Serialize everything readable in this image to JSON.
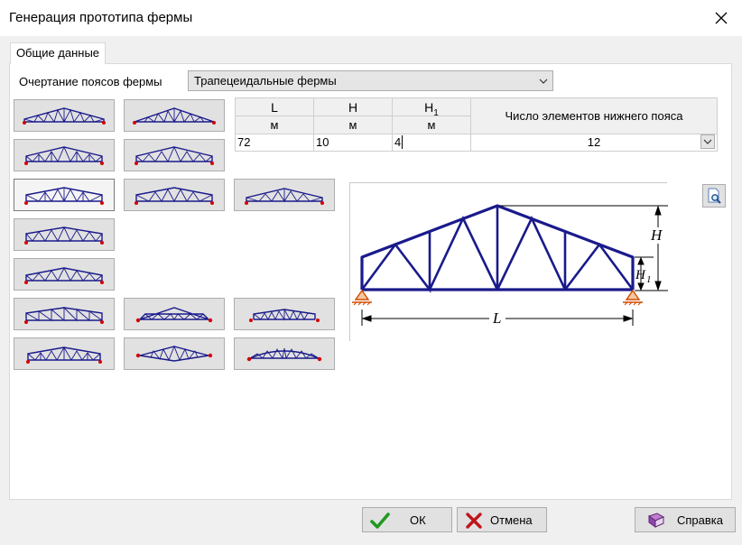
{
  "window": {
    "title": "Генерация прототипа фермы"
  },
  "tabs": [
    {
      "label": "Общие данные"
    }
  ],
  "outline": {
    "label": "Очертание поясов фермы",
    "selected": "Трапецеидальные фермы"
  },
  "params": {
    "columns": [
      {
        "name": "L",
        "unit": "м",
        "value": "72"
      },
      {
        "name": "H",
        "unit": "м",
        "value": "10"
      },
      {
        "name": "H",
        "sub": "1",
        "unit": "м",
        "value": "4"
      }
    ],
    "elements": {
      "header": "Число элементов нижнего пояса",
      "value": "12"
    }
  },
  "diagram": {
    "label_L": "L",
    "label_H": "H",
    "label_H1": "H",
    "label_H1_sub": "1"
  },
  "buttons": {
    "ok": "ОК",
    "cancel": "Отмена",
    "help": "Справка"
  },
  "colors": {
    "truss": "#1a1a8c",
    "support": "#d04a00",
    "ok_check": "#1f9a1f",
    "cancel_x": "#c0141a"
  },
  "icons": {
    "close": "close-icon",
    "dropdown": "chevron-down-icon",
    "preview": "preview-magnifier-icon",
    "ok": "checkmark-icon",
    "cancel": "x-icon",
    "help": "help-book-icon"
  }
}
